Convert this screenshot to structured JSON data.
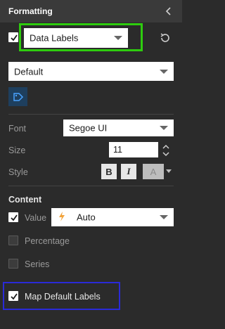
{
  "header": {
    "title": "Formatting"
  },
  "top": {
    "enabled": true,
    "dropdown_value": "Data Labels"
  },
  "preset": {
    "value": "Default"
  },
  "font": {
    "label": "Font",
    "value": "Segoe UI",
    "size_label": "Size",
    "size_value": "11",
    "style_label": "Style",
    "bold": "B",
    "italic": "I",
    "color_glyph": "A"
  },
  "content": {
    "title": "Content",
    "value": {
      "label": "Value",
      "checked": true,
      "option": "Auto"
    },
    "percentage": {
      "label": "Percentage",
      "checked": false
    },
    "series": {
      "label": "Series",
      "checked": false
    },
    "map_default": {
      "label": "Map Default Labels",
      "checked": true
    }
  },
  "colors": {
    "highlight_green": "#2ecc0e",
    "highlight_blue": "#2a2ad8",
    "lightning": "#f2a33a"
  }
}
